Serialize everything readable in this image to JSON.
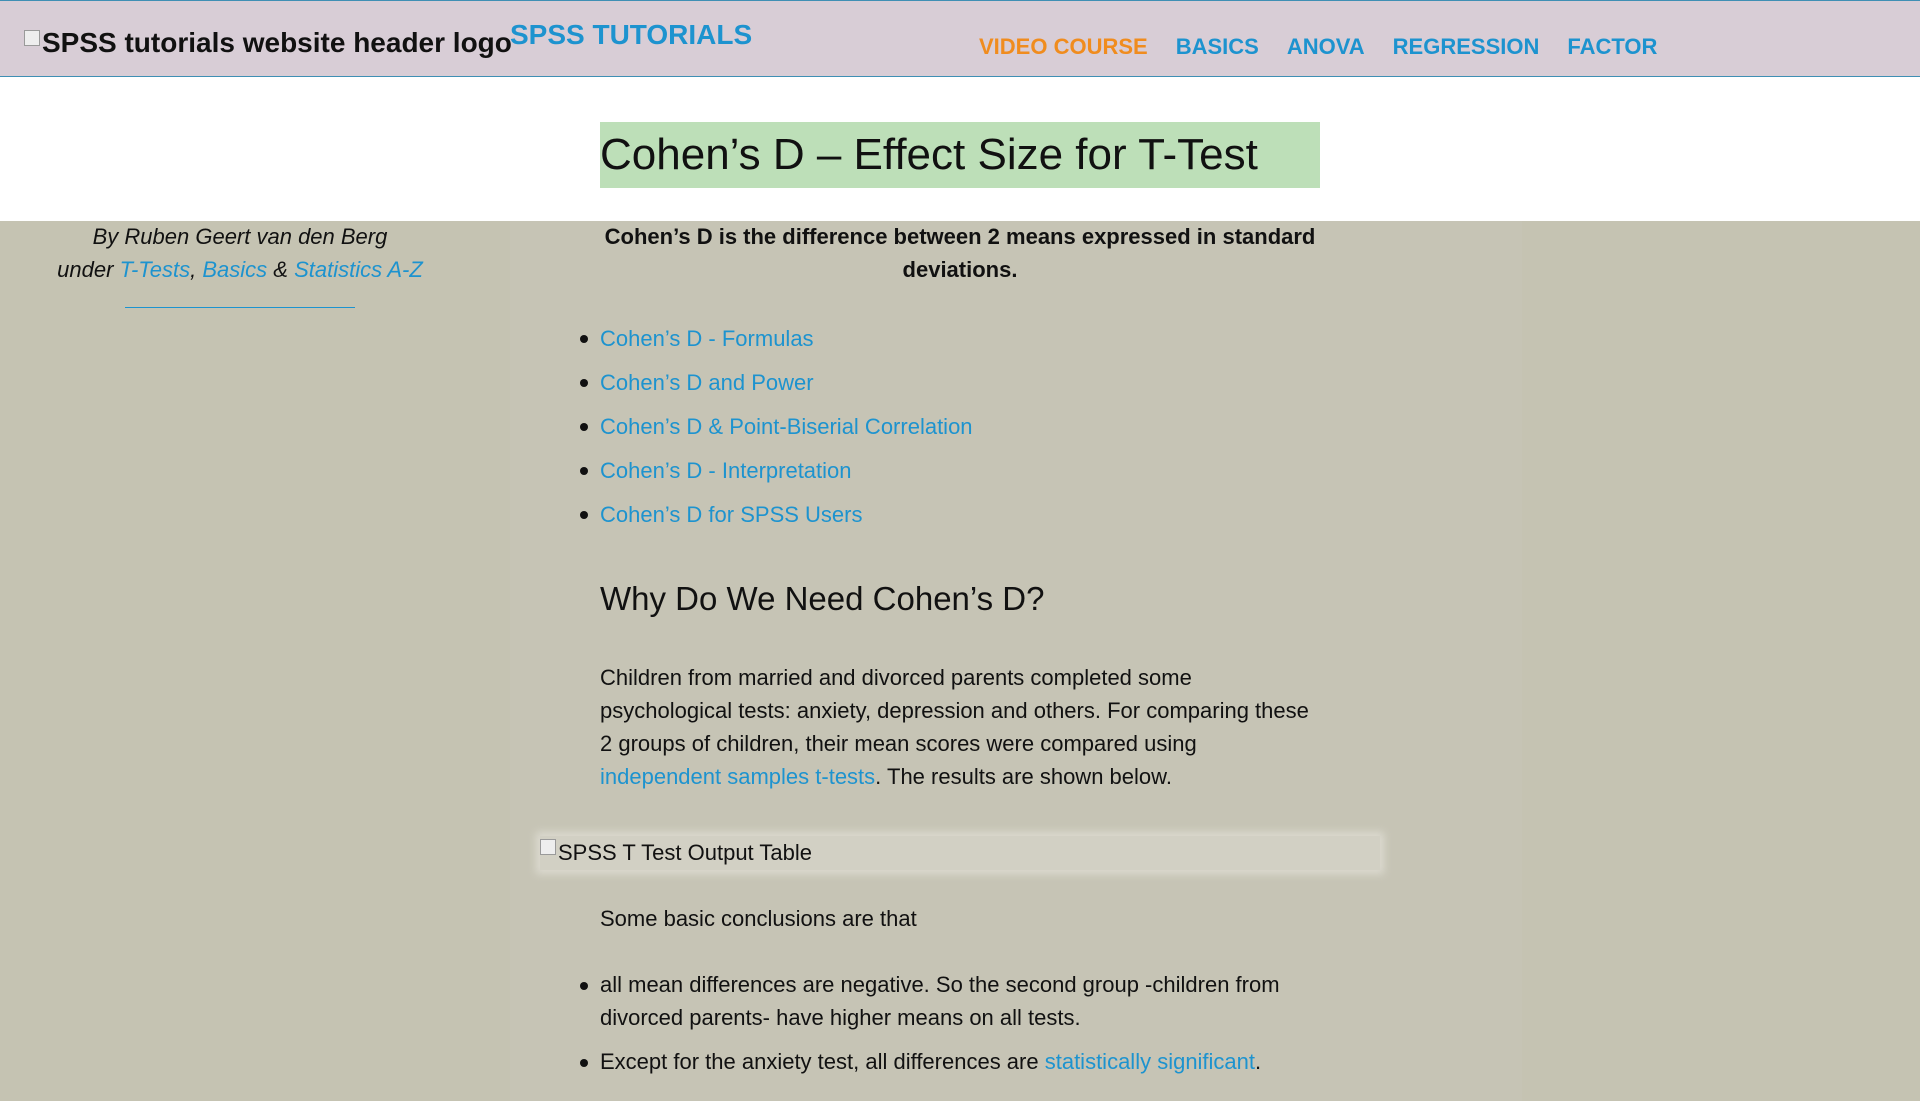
{
  "header": {
    "logo_alt": "SPSS tutorials website header logo",
    "site_title": "SPSS TUTORIALS",
    "nav": [
      {
        "label": "VIDEO COURSE",
        "active": true
      },
      {
        "label": "BASICS",
        "active": false
      },
      {
        "label": "ANOVA",
        "active": false
      },
      {
        "label": "REGRESSION",
        "active": false
      },
      {
        "label": "FACTOR",
        "active": false
      }
    ]
  },
  "page_title": "Cohen’s D – Effect Size for T-Test",
  "byline": {
    "author_prefix": "By Ruben Geert van den Berg",
    "under": "under",
    "cat1": "T-Tests",
    "sep1": ",",
    "cat2": "Basics",
    "sep2": "&",
    "cat3": "Statistics A-Z"
  },
  "intro": "Cohen’s D is the difference between 2 means expressed in standard deviations.",
  "toc": [
    "Cohen’s D - Formulas",
    "Cohen’s D and Power",
    "Cohen’s D & Point-Biserial Correlation",
    "Cohen’s D - Interpretation",
    "Cohen’s D for SPSS Users"
  ],
  "section_heading": "Why Do We Need Cohen’s D?",
  "paragraph": {
    "text_before": "Children from married and divorced parents completed some psychological tests: anxiety, depression and others. For comparing these 2 groups of children, their mean scores were compared using ",
    "link": "independent samples t-tests",
    "text_after": ". The results are shown below."
  },
  "output_table_alt": "SPSS T Test Output Table",
  "conclusions_intro": "Some basic conclusions are that",
  "conclusions": {
    "item1": "all mean differences are negative. So the second group -children from divorced parents- have higher means on all tests.",
    "item2_before": "Except for the anxiety test, all differences are ",
    "item2_link": "statistically significant",
    "item2_after": "."
  },
  "colors": {
    "link": "#1d93cf",
    "nav_active": "#f08c1e",
    "header_bg": "#d8cdd6",
    "title_highlight": "#bddfb8",
    "page_bg": "#c5c3b2"
  }
}
